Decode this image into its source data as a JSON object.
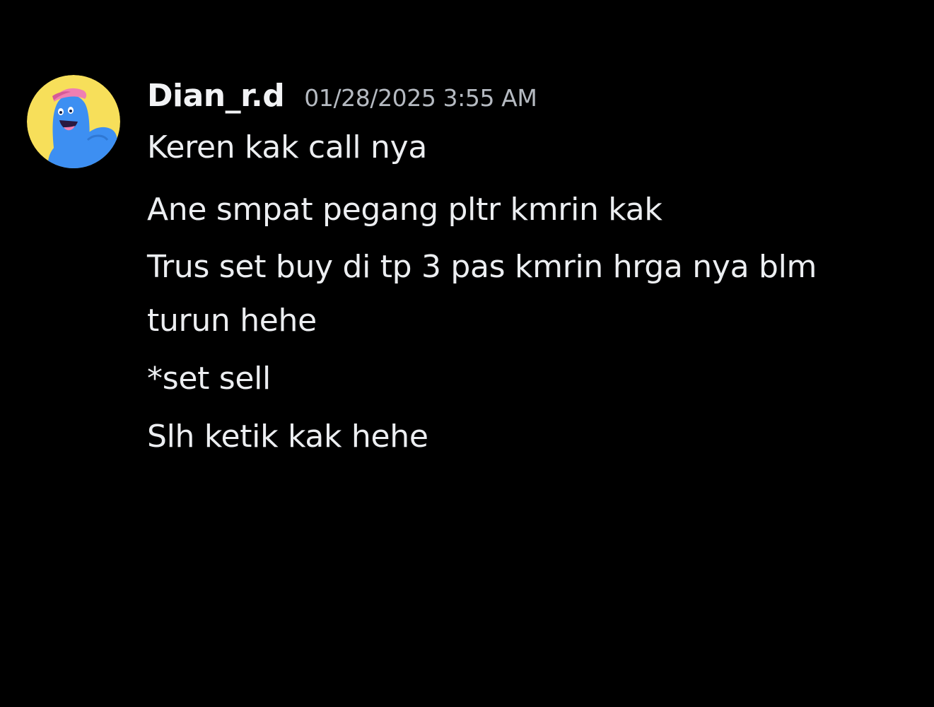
{
  "message": {
    "author": "Dian_r.d",
    "timestamp": "01/28/2025 3:55 AM",
    "avatar_icon": "blue-character-avatar-icon",
    "lines": [
      "Keren kak call nya",
      "Ane smpat pegang pltr kmrin kak",
      "Trus set buy di tp 3 pas kmrin hrga nya blm turun hehe",
      "*set sell",
      "Slh ketik kak hehe"
    ]
  },
  "colors": {
    "background": "#000000",
    "username": "#f2f3f5",
    "timestamp": "#b5bac1",
    "text": "#eceef1",
    "avatar_bg": "#f7df5a",
    "character": "#3d8ff2",
    "cap": "#ef7fb2"
  }
}
